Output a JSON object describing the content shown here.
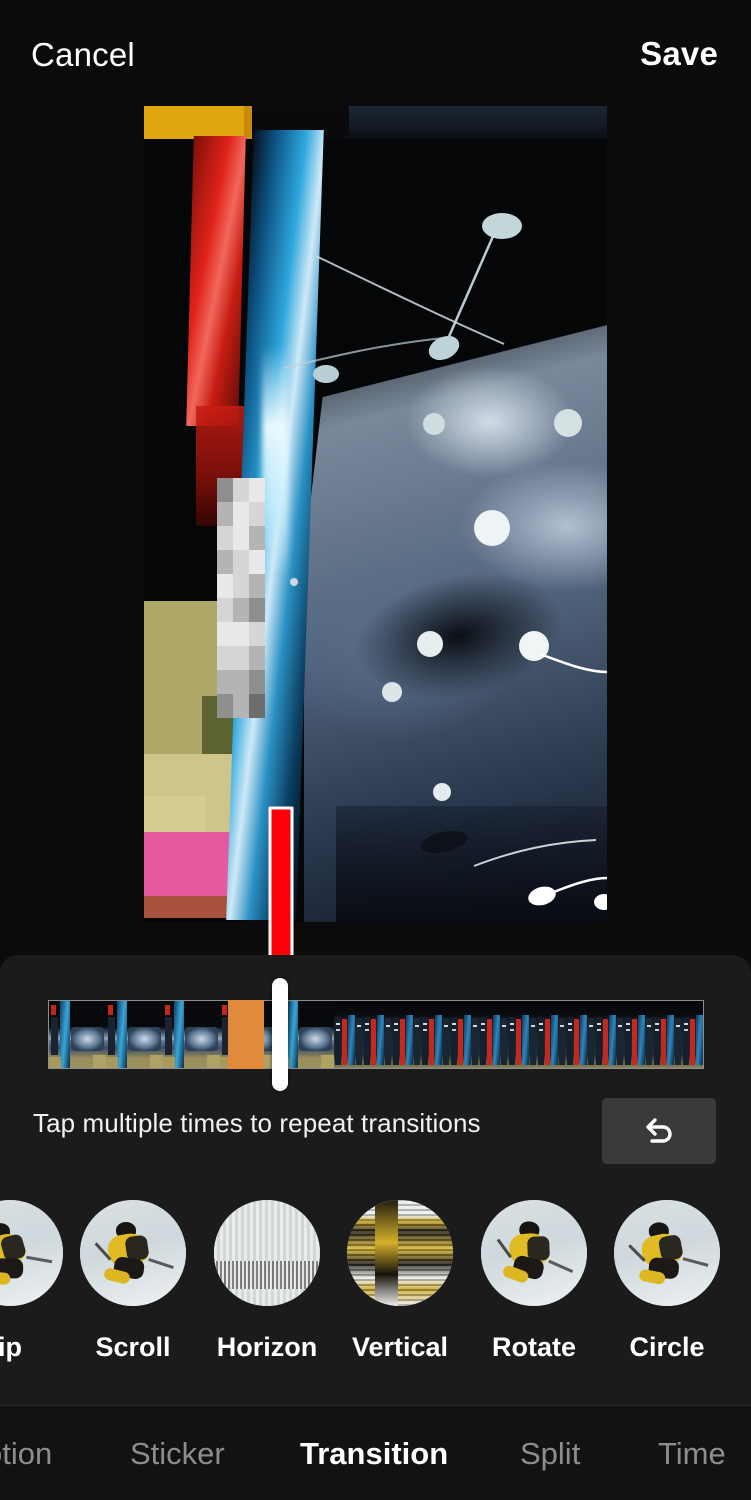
{
  "header": {
    "cancel_label": "Cancel",
    "save_label": "Save"
  },
  "preview": {
    "description": "video-preview-frame"
  },
  "timeline": {
    "playhead_position_pct": 35,
    "transition_marker_present": true,
    "marker_color": "#e08a3c"
  },
  "editor": {
    "hint_text": "Tap multiple times to repeat transitions",
    "undo_icon": "undo-arrow-icon"
  },
  "transitions": {
    "items": [
      {
        "label": "ip"
      },
      {
        "label": "Scroll"
      },
      {
        "label": "Horizon"
      },
      {
        "label": "Vertical"
      },
      {
        "label": "Rotate"
      },
      {
        "label": "Circle"
      }
    ]
  },
  "tabbar": {
    "tabs": [
      {
        "label": "otion",
        "active": false
      },
      {
        "label": "Sticker",
        "active": false
      },
      {
        "label": "Transition",
        "active": true
      },
      {
        "label": "Split",
        "active": false
      },
      {
        "label": "Time",
        "active": false
      }
    ]
  },
  "colors": {
    "background": "#0b0b0b",
    "panel": "#1b1b1b",
    "accent_marker": "#e08a3c",
    "annotation_arrow": "#fb0007",
    "active_tab": "#ffffff",
    "inactive_tab": "#8d8d8d"
  }
}
